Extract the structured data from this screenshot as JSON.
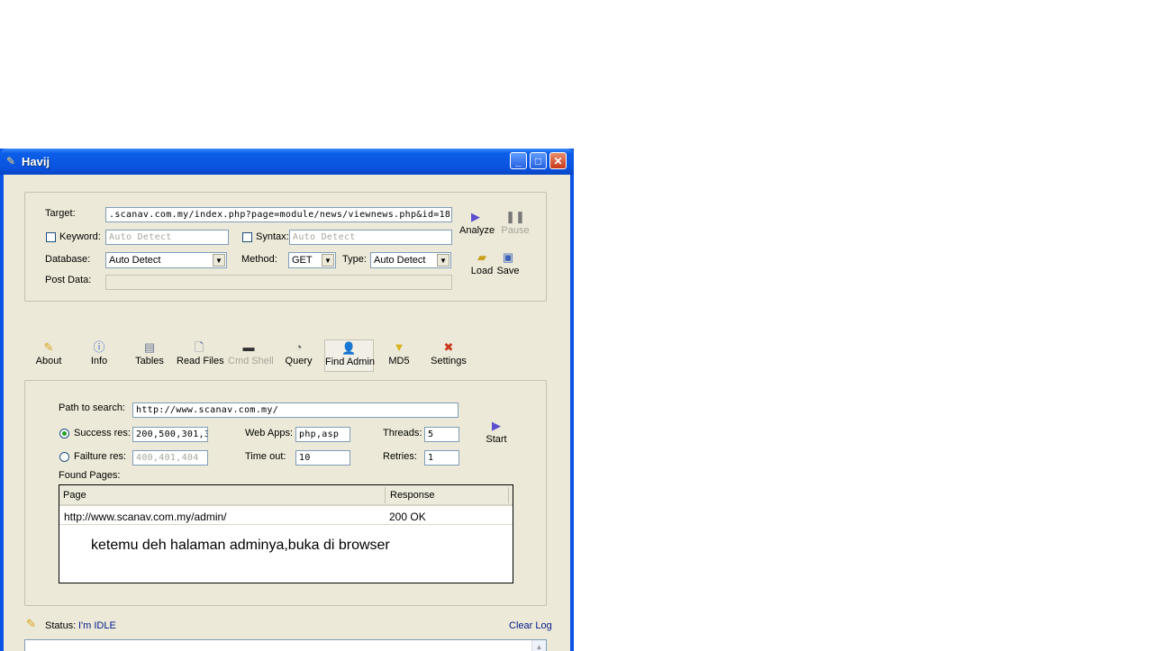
{
  "window": {
    "title": "Havij"
  },
  "target_panel": {
    "target_label": "Target:",
    "target_value": ".scanav.com.my/index.php?page=module/news/viewnews.php&id=18",
    "keyword_label": "Keyword:",
    "keyword_placeholder": "Auto Detect",
    "syntax_label": "Syntax:",
    "syntax_placeholder": "Auto Detect",
    "database_label": "Database:",
    "database_value": "Auto Detect",
    "method_label": "Method:",
    "method_value": "GET",
    "type_label": "Type:",
    "type_value": "Auto Detect",
    "postdata_label": "Post Data:",
    "analyze_label": "Analyze",
    "pause_label": "Pause",
    "load_label": "Load",
    "save_label": "Save"
  },
  "tabs": [
    {
      "label": "About",
      "icon": "about-icon"
    },
    {
      "label": "Info",
      "icon": "info-icon"
    },
    {
      "label": "Tables",
      "icon": "tables-icon"
    },
    {
      "label": "Read Files",
      "icon": "read-files-icon"
    },
    {
      "label": "Cmd Shell",
      "icon": "cmd-shell-icon"
    },
    {
      "label": "Query",
      "icon": "query-icon"
    },
    {
      "label": "Find Admin",
      "icon": "find-admin-icon"
    },
    {
      "label": "MD5",
      "icon": "md5-icon"
    },
    {
      "label": "Settings",
      "icon": "settings-icon"
    }
  ],
  "find_admin": {
    "path_label": "Path to search:",
    "path_value": "http://www.scanav.com.my/",
    "success_label": "Success res:",
    "success_value": "200,500,301,3",
    "failure_label": "Failture res:",
    "failure_value": "400,401,404",
    "webapps_label": "Web Apps:",
    "webapps_value": "php,asp",
    "timeout_label": "Time out:",
    "timeout_value": "10",
    "threads_label": "Threads:",
    "threads_value": "5",
    "retries_label": "Retries:",
    "retries_value": "1",
    "start_label": "Start",
    "found_label": "Found Pages:",
    "columns": [
      "Page",
      "Response"
    ],
    "rows": [
      {
        "page": "http://www.scanav.com.my/admin/",
        "response": "200 OK"
      }
    ],
    "note": "ketemu deh halaman adminya,buka di browser"
  },
  "status": {
    "label": "Status:",
    "value": "I'm IDLE",
    "clear_log": "Clear Log"
  },
  "colors": {
    "titlebar": "#0a54e0",
    "client_bg": "#ece9d8",
    "status_text": "#001a8c"
  }
}
